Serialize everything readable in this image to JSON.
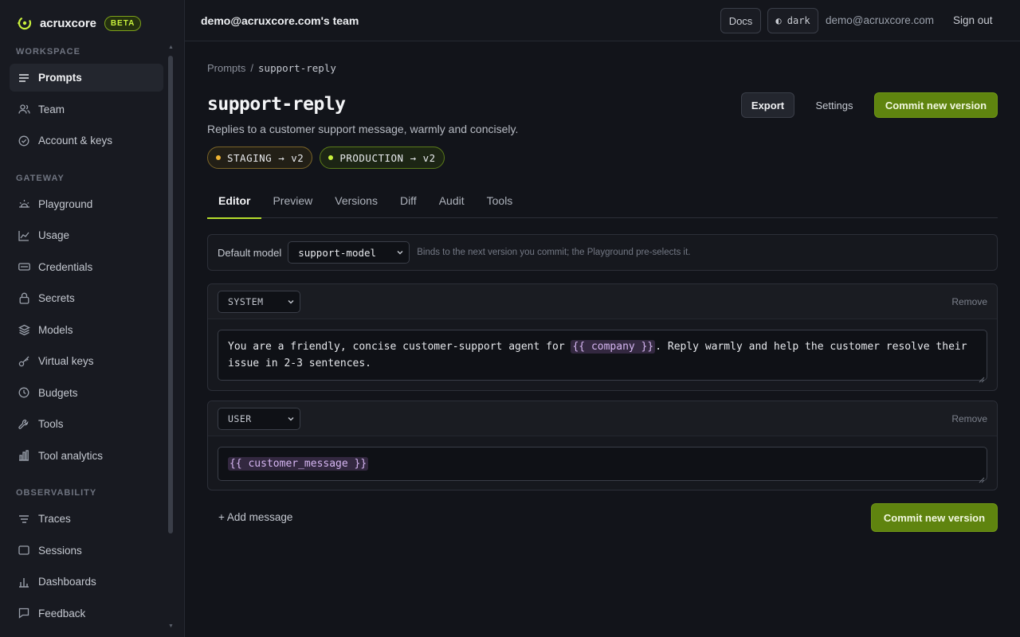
{
  "brand": {
    "name": "acruxcore",
    "badge": "BETA",
    "accent": "#c8f03c"
  },
  "sidebar": {
    "sections": [
      {
        "title": "WORKSPACE",
        "items": [
          {
            "label": "Prompts",
            "icon": "list-icon",
            "active": true
          },
          {
            "label": "Team",
            "icon": "users-icon"
          },
          {
            "label": "Account & keys",
            "icon": "check-circle-icon"
          }
        ]
      },
      {
        "title": "GATEWAY",
        "items": [
          {
            "label": "Playground",
            "icon": "sun-icon"
          },
          {
            "label": "Usage",
            "icon": "line-chart-icon"
          },
          {
            "label": "Credentials",
            "icon": "card-icon"
          },
          {
            "label": "Secrets",
            "icon": "lock-icon"
          },
          {
            "label": "Models",
            "icon": "layers-icon"
          },
          {
            "label": "Virtual keys",
            "icon": "key-icon"
          },
          {
            "label": "Budgets",
            "icon": "clock-icon"
          },
          {
            "label": "Tools",
            "icon": "wrench-icon"
          },
          {
            "label": "Tool analytics",
            "icon": "bar-chart-icon"
          }
        ]
      },
      {
        "title": "OBSERVABILITY",
        "items": [
          {
            "label": "Traces",
            "icon": "traces-icon"
          },
          {
            "label": "Sessions",
            "icon": "window-icon"
          },
          {
            "label": "Dashboards",
            "icon": "bar-chart-icon"
          },
          {
            "label": "Feedback",
            "icon": "message-icon"
          }
        ]
      }
    ]
  },
  "topbar": {
    "team": "demo@acruxcore.com's team",
    "docs": "Docs",
    "theme": "◐ dark",
    "email": "demo@acruxcore.com",
    "sign_out": "Sign out"
  },
  "page": {
    "breadcrumb_root": "Prompts",
    "breadcrumb_sep": "/",
    "breadcrumb_current": "support-reply",
    "title": "support-reply",
    "description": "Replies to a customer support message, warmly and concisely.",
    "badges": [
      {
        "label": "STAGING → v2",
        "color": "#f0b432"
      },
      {
        "label": "PRODUCTION → v2",
        "color": "#c8f03c"
      }
    ],
    "export": "Export",
    "settings": "Settings",
    "commit": "Commit new version",
    "tabs": [
      "Editor",
      "Preview",
      "Versions",
      "Diff",
      "Audit",
      "Tools"
    ],
    "active_tab": "Editor"
  },
  "editor": {
    "default_model_label": "Default model",
    "default_model": "support-model",
    "default_model_hint": "Binds to the next version you commit; the Playground pre-selects it.",
    "remove": "Remove",
    "messages": [
      {
        "role": "SYSTEM",
        "text_before": "You are a friendly, concise customer-support agent for ",
        "var": "{{ company }}",
        "text_after": ". Reply warmly and help the customer resolve their issue in 2-3 sentences."
      },
      {
        "role": "USER",
        "text_before": "",
        "var": "{{ customer_message }}",
        "text_after": ""
      }
    ],
    "add_message": "+ Add message",
    "commit": "Commit new version"
  }
}
